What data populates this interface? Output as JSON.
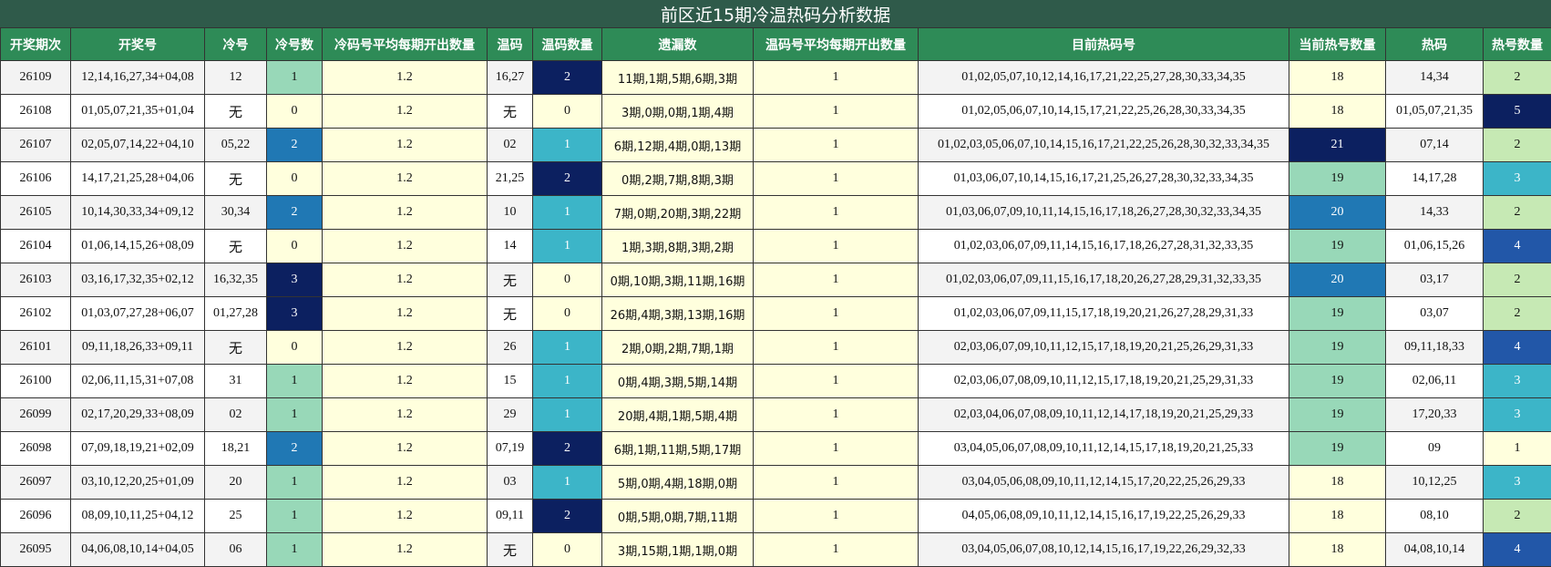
{
  "title": "前区近15期冷温热码分析数据",
  "columns": [
    "开奖期次",
    "开奖号",
    "冷号",
    "冷号数",
    "冷码号平均每期开出数量",
    "温码",
    "温码数量",
    "遗漏数",
    "温码号平均每期开出数量",
    "目前热码号",
    "当前热号数量",
    "热码",
    "热号数量"
  ],
  "colors": {
    "header_bg": "#2e8b57",
    "title_bg": "#2f5a4a",
    "yellow": "#ffffdd",
    "dark_navy": "#0c2060",
    "cyan": "#3cb5c8",
    "blue": "#2078b4",
    "mint": "#98d8b8",
    "light_green": "#c6e9b4",
    "royal_blue": "#2257a8"
  },
  "rows": [
    {
      "period": "26109",
      "numbers": "12,14,16,27,34+04,08",
      "cold": "12",
      "cold_count": "1",
      "cold_avg": "1.2",
      "warm": "16,27",
      "warm_count": "2",
      "missing": "11期,1期,5期,6期,3期",
      "warm_avg": "1",
      "hot_now": "01,02,05,07,10,12,14,16,17,21,22,25,27,28,30,33,34,35",
      "hot_now_count": "18",
      "hot": "14,34",
      "hot_count": "2"
    },
    {
      "period": "26108",
      "numbers": "01,05,07,21,35+01,04",
      "cold": "无",
      "cold_count": "0",
      "cold_avg": "1.2",
      "warm": "无",
      "warm_count": "0",
      "missing": "3期,0期,0期,1期,4期",
      "warm_avg": "1",
      "hot_now": "01,02,05,06,07,10,14,15,17,21,22,25,26,28,30,33,34,35",
      "hot_now_count": "18",
      "hot": "01,05,07,21,35",
      "hot_count": "5"
    },
    {
      "period": "26107",
      "numbers": "02,05,07,14,22+04,10",
      "cold": "05,22",
      "cold_count": "2",
      "cold_avg": "1.2",
      "warm": "02",
      "warm_count": "1",
      "missing": "6期,12期,4期,0期,13期",
      "warm_avg": "1",
      "hot_now": "01,02,03,05,06,07,10,14,15,16,17,21,22,25,26,28,30,32,33,34,35",
      "hot_now_count": "21",
      "hot": "07,14",
      "hot_count": "2"
    },
    {
      "period": "26106",
      "numbers": "14,17,21,25,28+04,06",
      "cold": "无",
      "cold_count": "0",
      "cold_avg": "1.2",
      "warm": "21,25",
      "warm_count": "2",
      "missing": "0期,2期,7期,8期,3期",
      "warm_avg": "1",
      "hot_now": "01,03,06,07,10,14,15,16,17,21,25,26,27,28,30,32,33,34,35",
      "hot_now_count": "19",
      "hot": "14,17,28",
      "hot_count": "3"
    },
    {
      "period": "26105",
      "numbers": "10,14,30,33,34+09,12",
      "cold": "30,34",
      "cold_count": "2",
      "cold_avg": "1.2",
      "warm": "10",
      "warm_count": "1",
      "missing": "7期,0期,20期,3期,22期",
      "warm_avg": "1",
      "hot_now": "01,03,06,07,09,10,11,14,15,16,17,18,26,27,28,30,32,33,34,35",
      "hot_now_count": "20",
      "hot": "14,33",
      "hot_count": "2"
    },
    {
      "period": "26104",
      "numbers": "01,06,14,15,26+08,09",
      "cold": "无",
      "cold_count": "0",
      "cold_avg": "1.2",
      "warm": "14",
      "warm_count": "1",
      "missing": "1期,3期,8期,3期,2期",
      "warm_avg": "1",
      "hot_now": "01,02,03,06,07,09,11,14,15,16,17,18,26,27,28,31,32,33,35",
      "hot_now_count": "19",
      "hot": "01,06,15,26",
      "hot_count": "4"
    },
    {
      "period": "26103",
      "numbers": "03,16,17,32,35+02,12",
      "cold": "16,32,35",
      "cold_count": "3",
      "cold_avg": "1.2",
      "warm": "无",
      "warm_count": "0",
      "missing": "0期,10期,3期,11期,16期",
      "warm_avg": "1",
      "hot_now": "01,02,03,06,07,09,11,15,16,17,18,20,26,27,28,29,31,32,33,35",
      "hot_now_count": "20",
      "hot": "03,17",
      "hot_count": "2"
    },
    {
      "period": "26102",
      "numbers": "01,03,07,27,28+06,07",
      "cold": "01,27,28",
      "cold_count": "3",
      "cold_avg": "1.2",
      "warm": "无",
      "warm_count": "0",
      "missing": "26期,4期,3期,13期,16期",
      "warm_avg": "1",
      "hot_now": "01,02,03,06,07,09,11,15,17,18,19,20,21,26,27,28,29,31,33",
      "hot_now_count": "19",
      "hot": "03,07",
      "hot_count": "2"
    },
    {
      "period": "26101",
      "numbers": "09,11,18,26,33+09,11",
      "cold": "无",
      "cold_count": "0",
      "cold_avg": "1.2",
      "warm": "26",
      "warm_count": "1",
      "missing": "2期,0期,2期,7期,1期",
      "warm_avg": "1",
      "hot_now": "02,03,06,07,09,10,11,12,15,17,18,19,20,21,25,26,29,31,33",
      "hot_now_count": "19",
      "hot": "09,11,18,33",
      "hot_count": "4"
    },
    {
      "period": "26100",
      "numbers": "02,06,11,15,31+07,08",
      "cold": "31",
      "cold_count": "1",
      "cold_avg": "1.2",
      "warm": "15",
      "warm_count": "1",
      "missing": "0期,4期,3期,5期,14期",
      "warm_avg": "1",
      "hot_now": "02,03,06,07,08,09,10,11,12,15,17,18,19,20,21,25,29,31,33",
      "hot_now_count": "19",
      "hot": "02,06,11",
      "hot_count": "3"
    },
    {
      "period": "26099",
      "numbers": "02,17,20,29,33+08,09",
      "cold": "02",
      "cold_count": "1",
      "cold_avg": "1.2",
      "warm": "29",
      "warm_count": "1",
      "missing": "20期,4期,1期,5期,4期",
      "warm_avg": "1",
      "hot_now": "02,03,04,06,07,08,09,10,11,12,14,17,18,19,20,21,25,29,33",
      "hot_now_count": "19",
      "hot": "17,20,33",
      "hot_count": "3"
    },
    {
      "period": "26098",
      "numbers": "07,09,18,19,21+02,09",
      "cold": "18,21",
      "cold_count": "2",
      "cold_avg": "1.2",
      "warm": "07,19",
      "warm_count": "2",
      "missing": "6期,1期,11期,5期,17期",
      "warm_avg": "1",
      "hot_now": "03,04,05,06,07,08,09,10,11,12,14,15,17,18,19,20,21,25,33",
      "hot_now_count": "19",
      "hot": "09",
      "hot_count": "1"
    },
    {
      "period": "26097",
      "numbers": "03,10,12,20,25+01,09",
      "cold": "20",
      "cold_count": "1",
      "cold_avg": "1.2",
      "warm": "03",
      "warm_count": "1",
      "missing": "5期,0期,4期,18期,0期",
      "warm_avg": "1",
      "hot_now": "03,04,05,06,08,09,10,11,12,14,15,17,20,22,25,26,29,33",
      "hot_now_count": "18",
      "hot": "10,12,25",
      "hot_count": "3"
    },
    {
      "period": "26096",
      "numbers": "08,09,10,11,25+04,12",
      "cold": "25",
      "cold_count": "1",
      "cold_avg": "1.2",
      "warm": "09,11",
      "warm_count": "2",
      "missing": "0期,5期,0期,7期,11期",
      "warm_avg": "1",
      "hot_now": "04,05,06,08,09,10,11,12,14,15,16,17,19,22,25,26,29,33",
      "hot_now_count": "18",
      "hot": "08,10",
      "hot_count": "2"
    },
    {
      "period": "26095",
      "numbers": "04,06,08,10,14+04,05",
      "cold": "06",
      "cold_count": "1",
      "cold_avg": "1.2",
      "warm": "无",
      "warm_count": "0",
      "missing": "3期,15期,1期,1期,0期",
      "warm_avg": "1",
      "hot_now": "03,04,05,06,07,08,10,12,14,15,16,17,19,22,26,29,32,33",
      "hot_now_count": "18",
      "hot": "04,08,10,14",
      "hot_count": "4"
    }
  ]
}
